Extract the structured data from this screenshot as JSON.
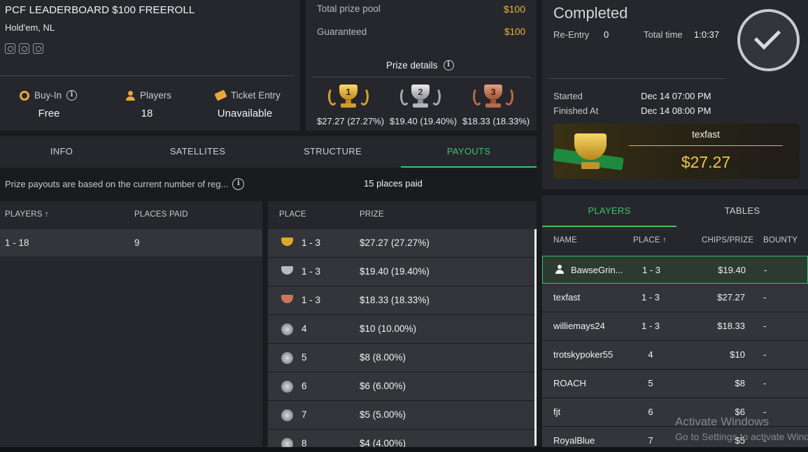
{
  "tournament": {
    "title": "PCF LEADERBOARD $100 FREEROLL",
    "game": "Hold'em, NL",
    "buyin_label": "Buy-In",
    "buyin_value": "Free",
    "players_label": "Players",
    "players_value": "18",
    "ticket_label": "Ticket Entry",
    "ticket_value": "Unavailable"
  },
  "prize_pool": {
    "total_label": "Total prize pool",
    "total_value": "$100",
    "guaranteed_label": "Guaranteed",
    "guaranteed_value": "$100",
    "details_label": "Prize details",
    "top3": [
      {
        "rank": "1",
        "amount": "$27.27 (27.27%)"
      },
      {
        "rank": "2",
        "amount": "$19.40 (19.40%)"
      },
      {
        "rank": "3",
        "amount": "$18.33 (18.33%)"
      }
    ]
  },
  "status": {
    "title": "Completed",
    "reentry_label": "Re-Entry",
    "reentry_value": "0",
    "total_time_label": "Total time",
    "total_time_value": "1:0:37",
    "started_label": "Started",
    "started_value": "Dec 14 07:00 PM",
    "finished_label": "Finished At",
    "finished_value": "Dec 14 08:00 PM",
    "winner_name": "texfast",
    "winner_amount": "$27.27"
  },
  "tabs": [
    "INFO",
    "SATELLITES",
    "STRUCTURE",
    "PAYOUTS"
  ],
  "active_tab": "PAYOUTS",
  "payout_note": "Prize payouts are based on the current number of reg...",
  "places_paid_text": "15 places paid",
  "left_table": {
    "headers": [
      "PLAYERS ↑",
      "PLACES PAID"
    ],
    "rows": [
      {
        "players": "1 - 18",
        "places": "9"
      }
    ]
  },
  "payouts_table": {
    "headers": [
      "PLACE",
      "PRIZE"
    ],
    "rows": [
      {
        "place": "1 - 3",
        "prize": "$27.27 (27.27%)",
        "icon": "gold-trophy-icon"
      },
      {
        "place": "1 - 3",
        "prize": "$19.40 (19.40%)",
        "icon": "silver-trophy-icon"
      },
      {
        "place": "1 - 3",
        "prize": "$18.33 (18.33%)",
        "icon": "bronze-trophy-icon"
      },
      {
        "place": "4",
        "prize": "$10 (10.00%)",
        "icon": "star-badge-icon"
      },
      {
        "place": "5",
        "prize": "$8 (8.00%)",
        "icon": "star-badge-icon"
      },
      {
        "place": "6",
        "prize": "$6 (6.00%)",
        "icon": "star-badge-icon"
      },
      {
        "place": "7",
        "prize": "$5 (5.00%)",
        "icon": "star-badge-icon"
      },
      {
        "place": "8",
        "prize": "$4 (4.00%)",
        "icon": "star-badge-icon"
      }
    ]
  },
  "players_panel": {
    "tabs": [
      "PLAYERS",
      "TABLES"
    ],
    "active_tab": "PLAYERS",
    "headers": [
      "NAME",
      "PLACE ↑",
      "CHIPS/PRIZE",
      "BOUNTY"
    ],
    "rows": [
      {
        "name": "BawseGrin...",
        "place": "1 - 3",
        "chips": "$19.40",
        "bounty": "-",
        "me": true
      },
      {
        "name": "texfast",
        "place": "1 - 3",
        "chips": "$27.27",
        "bounty": "-"
      },
      {
        "name": "williemays24",
        "place": "1 - 3",
        "chips": "$18.33",
        "bounty": "-"
      },
      {
        "name": "trotskypoker55",
        "place": "4",
        "chips": "$10",
        "bounty": "-"
      },
      {
        "name": "ROACH",
        "place": "5",
        "chips": "$8",
        "bounty": "-"
      },
      {
        "name": "fjt",
        "place": "6",
        "chips": "$6",
        "bounty": "-"
      },
      {
        "name": "RoyalBlue",
        "place": "7",
        "chips": "$5",
        "bounty": "-"
      }
    ]
  },
  "watermark": {
    "line1": "Activate Windows",
    "line2": "Go to Settings to activate Windows."
  },
  "colors": {
    "accent_green": "#39c46a",
    "gold": "#e9b33a",
    "panel": "#26272c",
    "row": "#34353b",
    "background": "#1a1b1f"
  }
}
